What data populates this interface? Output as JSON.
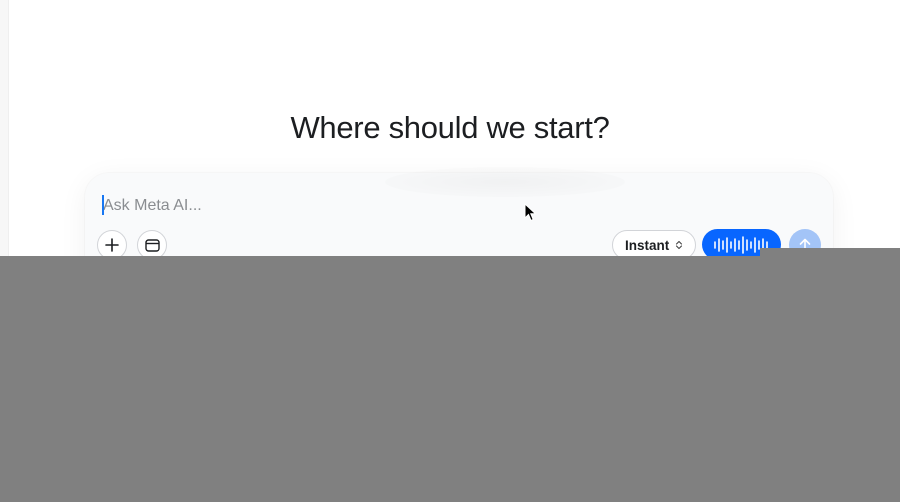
{
  "main": {
    "heading": "Where should we start?"
  },
  "composer": {
    "input_value": "",
    "input_placeholder": "Ask Meta AI...",
    "mode_select": {
      "selected": "Instant",
      "icon": "chevron-up-down-icon"
    },
    "attach_icon": "plus-icon",
    "canvas_icon": "window-icon",
    "voice_icon": "waveform-icon",
    "send_icon": "arrow-up-icon"
  },
  "colors": {
    "accent": "#0866ff",
    "send_disabled": "#a3c4f7",
    "overlay": "#808080",
    "caret": "#1877f2"
  }
}
